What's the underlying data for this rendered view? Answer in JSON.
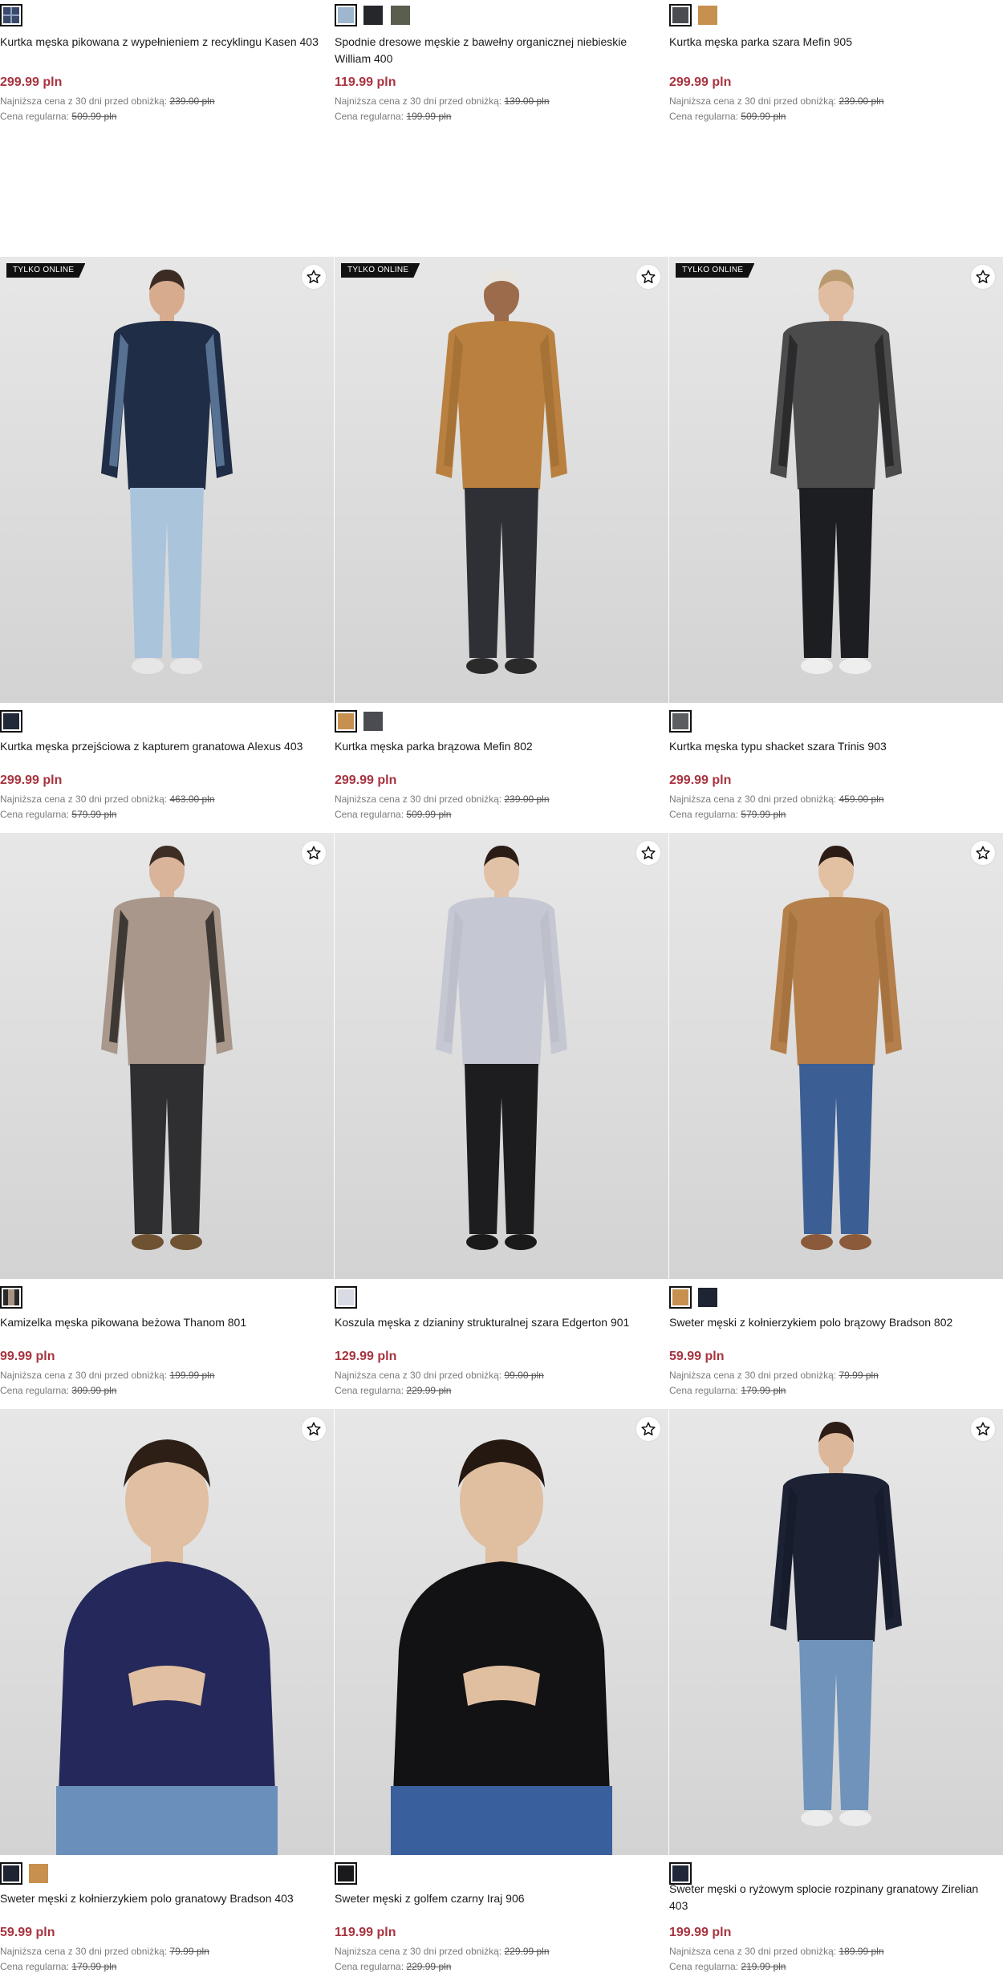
{
  "colors": {
    "price": "#a7333f",
    "badge_bg": "#111111",
    "muted_text": "#7a7a7a"
  },
  "labels": {
    "lowest_price": "Najniższa cena z 30 dni przed obniżką:",
    "regular_price": "Cena regularna:"
  },
  "top_row": [
    {
      "name": "Kurtka męska pikowana z wypełnieniem z recyklingu Kasen 403",
      "price": "299.99 pln",
      "lowest": "239.00 pln",
      "regular": "509.99 pln",
      "swatches": [
        {
          "color": "#3b4a6b",
          "selected": true,
          "icon": "pattern-swatch"
        }
      ]
    },
    {
      "name": "Spodnie dresowe męskie z bawełny organicznej niebieskie William 400",
      "price": "119.99 pln",
      "lowest": "139.00 pln",
      "regular": "199.99 pln",
      "swatches": [
        {
          "color": "#9fb6cf",
          "selected": true
        },
        {
          "color": "#26272b",
          "selected": false
        },
        {
          "color": "#5a5e4e",
          "selected": false
        }
      ]
    },
    {
      "name": "Kurtka męska parka szara Mefin 905",
      "price": "299.99 pln",
      "lowest": "239.00 pln",
      "regular": "509.99 pln",
      "swatches": [
        {
          "color": "#4a4c52",
          "selected": true
        },
        {
          "color": "#c7904f",
          "selected": false
        }
      ]
    }
  ],
  "rows": [
    [
      {
        "badge": "TYLKO ONLINE",
        "name": "Kurtka męska przejściowa z kapturem granatowa Alexus 403",
        "price": "299.99 pln",
        "lowest": "463.00 pln",
        "regular": "579.99 pln",
        "figure": {
          "top": "#1f2d46",
          "accent": "#6d8fb0",
          "bottom": "#aac4dc",
          "shoes": "#e6e6e6",
          "skin": "#d7ab8e",
          "hair": "#3b2b22"
        },
        "swatches": [
          {
            "color": "#20283a",
            "selected": true
          }
        ]
      },
      {
        "badge": "TYLKO ONLINE",
        "name": "Kurtka męska parka brązowa Mefin 802",
        "price": "299.99 pln",
        "lowest": "239.00 pln",
        "regular": "509.99 pln",
        "figure": {
          "top": "#b9803f",
          "accent": "#a06c33",
          "bottom": "#2f3036",
          "shoes": "#2a2a2a",
          "skin": "#9b6b4b",
          "hair": "#e9e6df"
        },
        "swatches": [
          {
            "color": "#c7904f",
            "selected": true
          },
          {
            "color": "#4a4c52",
            "selected": false
          }
        ]
      },
      {
        "badge": "TYLKO ONLINE",
        "name": "Kurtka męska typu shacket szara Trinis 903",
        "price": "299.99 pln",
        "lowest": "459.00 pln",
        "regular": "579.99 pln",
        "figure": {
          "top": "#4b4b4c",
          "accent": "#1e1e22",
          "bottom": "#1d1e22",
          "shoes": "#eeeeee",
          "skin": "#e0bca0",
          "hair": "#b89a6e"
        },
        "swatches": [
          {
            "color": "#5d5e62",
            "selected": true
          }
        ]
      }
    ],
    [
      {
        "badge": "",
        "name": "Kamizelka męska pikowana beżowa Thanom 801",
        "price": "99.99 pln",
        "lowest": "199.99 pln",
        "regular": "309.99 pln",
        "figure": {
          "top": "#a8978a",
          "accent": "#111111",
          "bottom": "#2f2f31",
          "shoes": "#6e5232",
          "skin": "#d9b39a",
          "hair": "#3d2d24"
        },
        "swatches": [
          {
            "color": "#a89483",
            "selected": true,
            "icon": "split-swatch"
          }
        ]
      },
      {
        "badge": "",
        "name": "Koszula męska z dzianiny strukturalnej szara Edgerton 901",
        "price": "129.99 pln",
        "lowest": "99.00 pln",
        "regular": "229.99 pln",
        "figure": {
          "top": "#c5c8d2",
          "accent": "#b9bcc6",
          "bottom": "#1d1d20",
          "shoes": "#1a1a1a",
          "skin": "#e2c2a6",
          "hair": "#2a1d15"
        },
        "swatches": [
          {
            "color": "#d8dbe4",
            "selected": true
          }
        ]
      },
      {
        "badge": "",
        "name": "Sweter męski z kołnierzykiem polo brązowy Bradson 802",
        "price": "59.99 pln",
        "lowest": "79.99 pln",
        "regular": "179.99 pln",
        "figure": {
          "top": "#b57f4b",
          "accent": "#a06c3b",
          "bottom": "#3b5f94",
          "shoes": "#8a5a3a",
          "skin": "#e2c0a2",
          "hair": "#2b1d15"
        },
        "swatches": [
          {
            "color": "#c7904f",
            "selected": true
          },
          {
            "color": "#1f2433",
            "selected": false
          }
        ]
      }
    ],
    [
      {
        "badge": "",
        "name": "Sweter męski z kołnierzykiem polo granatowy Bradson 403",
        "price": "59.99 pln",
        "lowest": "79.99 pln",
        "regular": "179.99 pln",
        "figure": {
          "top": "#25285a",
          "accent": "#1e2150",
          "bottom": "#6b8fbb",
          "shoes": "#333333",
          "skin": "#e0bfa2",
          "hair": "#2e1f16"
        },
        "swatches": [
          {
            "color": "#1f2433",
            "selected": true
          },
          {
            "color": "#c7904f",
            "selected": false
          }
        ]
      },
      {
        "badge": "",
        "name": "Sweter męski z golfem czarny Iraj 906",
        "price": "119.99 pln",
        "lowest": "229.99 pln",
        "regular": "229.99 pln",
        "figure": {
          "top": "#121214",
          "accent": "#1a1a1d",
          "bottom": "#3a5f9d",
          "shoes": "#333333",
          "skin": "#e0bea0",
          "hair": "#241810"
        },
        "swatches": [
          {
            "color": "#1a1a1c",
            "selected": true
          }
        ]
      },
      {
        "badge": "",
        "name": "Sweter męski o ryżowym splocie rozpinany granatowy Zirelian 403",
        "price": "199.99 pln",
        "lowest": "189.99 pln",
        "regular": "219.99 pln",
        "figure": {
          "top": "#1c2234",
          "accent": "#141a28",
          "bottom": "#6f93ba",
          "shoes": "#ececec",
          "skin": "#dcb79a",
          "hair": "#2b1d15"
        },
        "swatches": [
          {
            "color": "#20283a",
            "selected": true
          }
        ]
      }
    ]
  ]
}
